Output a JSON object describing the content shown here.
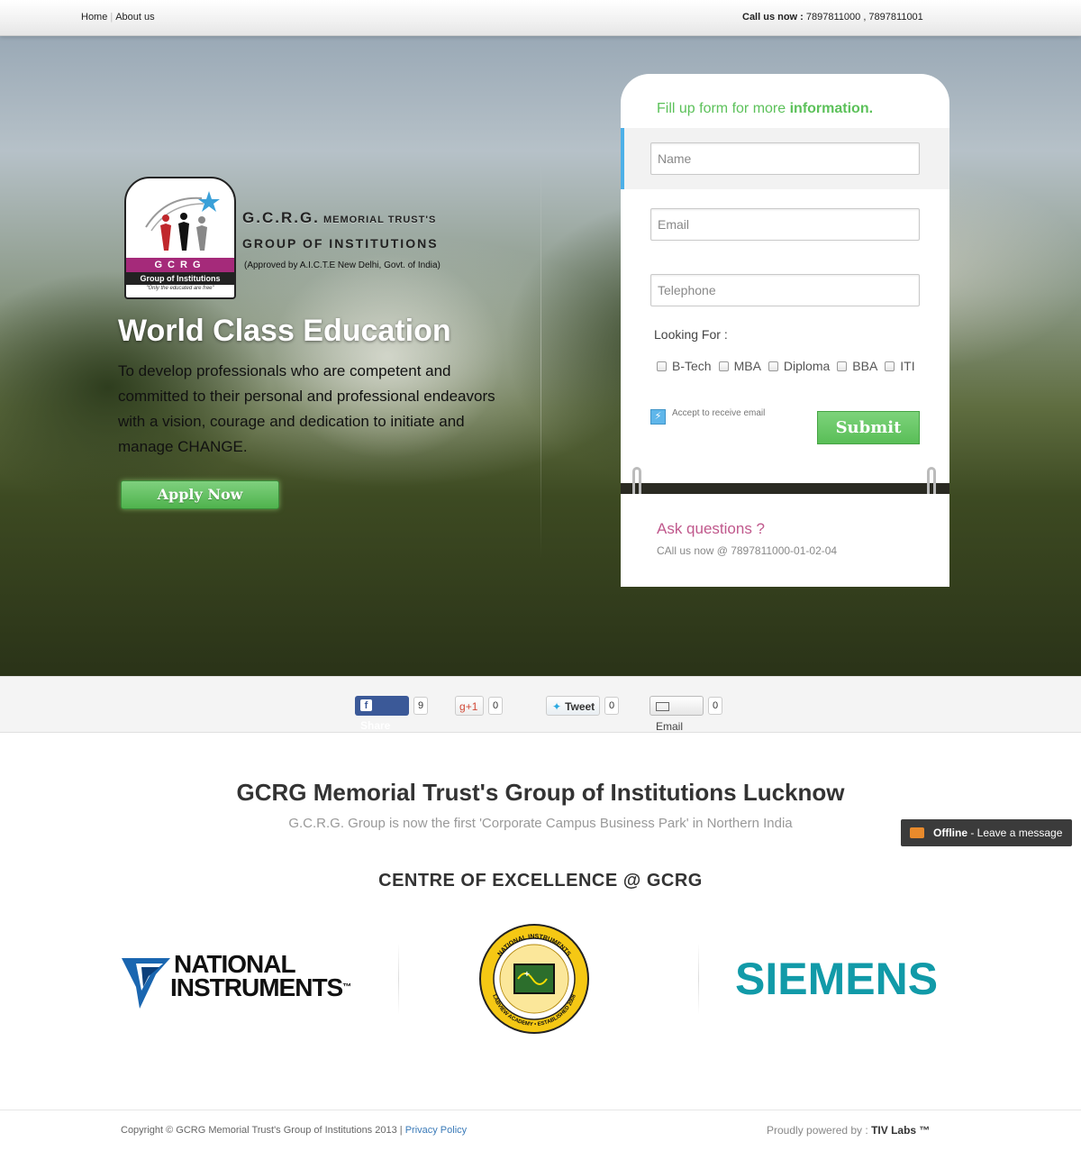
{
  "nav": {
    "home": "Home",
    "about": "About us"
  },
  "callus": {
    "label": "Call us now :",
    "numbers": "7897811000 , 7897811001"
  },
  "logo": {
    "band": "GCRG",
    "band2": "Group of Institutions",
    "tagline": "\"Only the educated are free\"",
    "title1a": "G.C.R.G.",
    "title1b": " MEMORIAL TRUST'S",
    "title2": "GROUP OF INSTITUTIONS",
    "approved": "(Approved by A.I.C.T.E New Delhi, Govt.  of India)"
  },
  "hero": {
    "heading": "World Class Education",
    "text": "To develop professionals who are competent and committed to their personal and professional endeavors with a vision, courage and dedication to initiate and manage CHANGE.",
    "apply": "Apply Now"
  },
  "form": {
    "title_plain": "Fill up form for more ",
    "title_bold": "information.",
    "name_placeholder": "Name",
    "email_placeholder": "Email",
    "tel_placeholder": "Telephone",
    "looking_for": "Looking For :",
    "options": [
      "B-Tech",
      "MBA",
      "Diploma",
      "BBA",
      "ITI"
    ],
    "accept": "Accept to receive email",
    "submit": "Submit",
    "ask_title": "Ask questions ?",
    "ask_phone": "CAll us now @ 7897811000-01-02-04"
  },
  "share": {
    "facebook": {
      "label": "Share",
      "count": "9"
    },
    "gplus": {
      "label": "+1",
      "count": "0"
    },
    "twitter": {
      "label": "Tweet",
      "count": "0"
    },
    "email": {
      "label": "Email",
      "count": "0"
    }
  },
  "main": {
    "title": "GCRG Memorial Trust's Group of Institutions Lucknow",
    "subtitle": "G.C.R.G. Group is now the first 'Corporate Campus Business Park' in Northern India",
    "coe": "CENTRE OF EXCELLENCE @ GCRG"
  },
  "chat": {
    "status": "Offline",
    "message": " - Leave a message"
  },
  "partners": {
    "ni_line1": "NATIONAL",
    "ni_line2": "INSTRUMENTS",
    "ni_tm": "™",
    "seal_top": "NATIONAL INSTRUMENTS",
    "seal_bottom": "LABVIEW ACADEMY • ESTABLISHED 2008",
    "siemens": "SIEMENS"
  },
  "footer": {
    "copyright": "Copyright © GCRG Memorial Trust's Group of Institutions 2013 | ",
    "privacy": "Privacy Policy",
    "powered": "Proudly powered by : ",
    "powered_by": "TIV Labs ™"
  },
  "colors": {
    "accent_green": "#5cc15a",
    "ask_pink": "#c0588c",
    "siemens_teal": "#119aa8",
    "facebook_blue": "#3b5998"
  },
  "icons": [
    "facebook-icon",
    "twitter-bird-icon",
    "envelope-icon",
    "chat-icon",
    "lightning-icon"
  ]
}
